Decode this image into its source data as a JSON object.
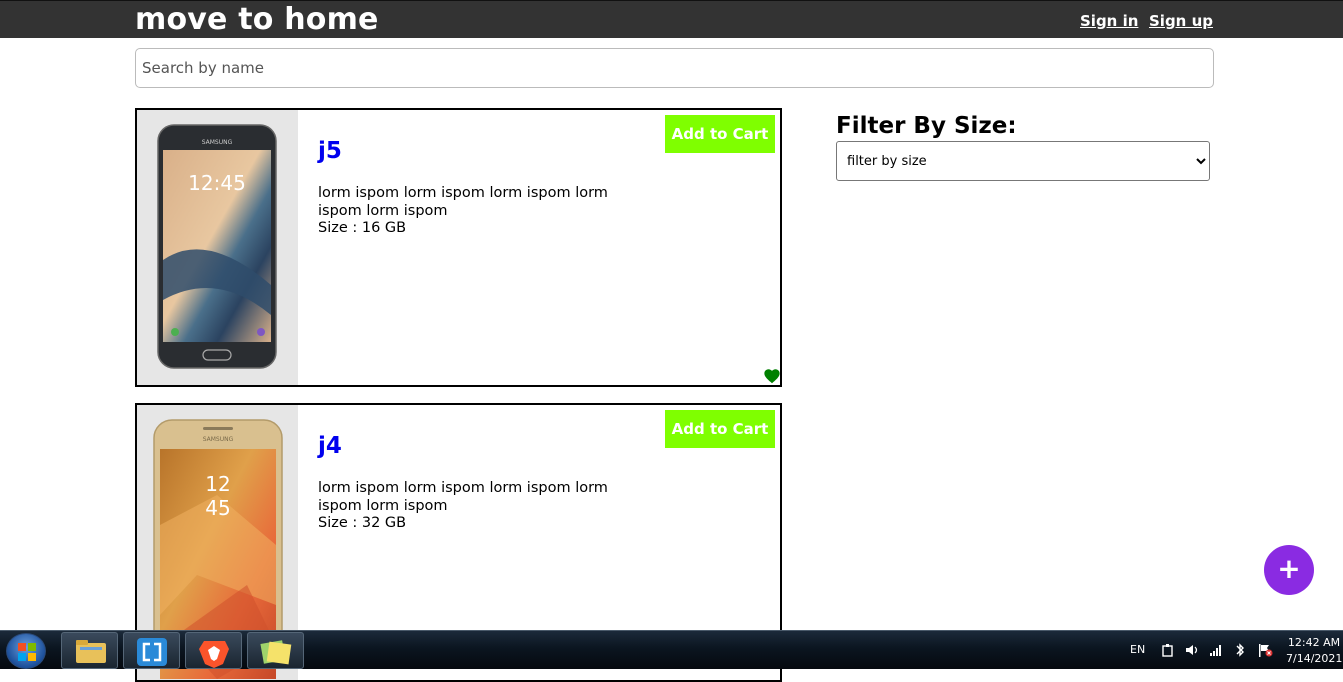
{
  "header": {
    "brand": "move to home",
    "signin_label": "Sign in",
    "signup_label": "Sign up"
  },
  "search": {
    "placeholder": "Search by name",
    "value": ""
  },
  "products": [
    {
      "name": "j5",
      "description": "lorm ispom lorm ispom lorm ispom lorm ispom lorm ispom",
      "size_text": "Size : 16 GB",
      "add_label": "Add to Cart",
      "phone_color": "black",
      "favorited": true
    },
    {
      "name": "j4",
      "description": "lorm ispom lorm ispom lorm ispom lorm ispom lorm ispom",
      "size_text": "Size : 32 GB",
      "add_label": "Add to Cart",
      "phone_color": "gold",
      "favorited": false
    }
  ],
  "filter": {
    "title": "Filter By Size:",
    "selected": "filter by size"
  },
  "fab": {
    "label": "+"
  },
  "taskbar": {
    "apps": [
      "file-explorer-icon",
      "app-icon",
      "brave-browser-icon",
      "sticky-notes-icon"
    ],
    "language": "EN",
    "time": "12:42 AM",
    "date": "7/14/2021"
  },
  "colors": {
    "topbar": "#333333",
    "product_title": "#0000ee",
    "add_button": "#7fff00",
    "heart": "#008000",
    "fab": "#8a2be2"
  }
}
